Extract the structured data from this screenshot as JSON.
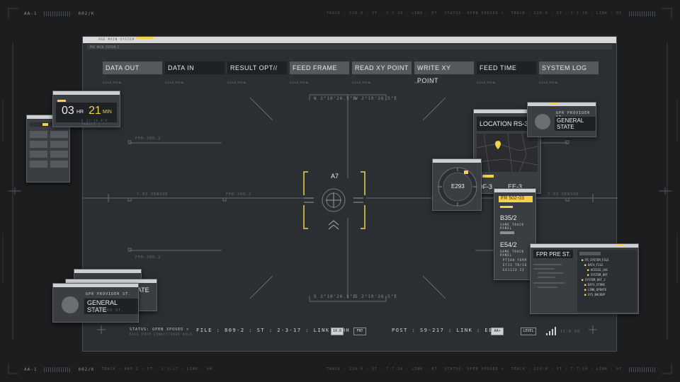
{
  "top_strip": {
    "left_code": "AA-1",
    "mid_code": "002/K",
    "track": "TRACK : 220-0 : ST : 7-7-10 : LINK : 07",
    "status": "STATUS: OPEN XPOSED >",
    "track2": "TRACK : 220-0 : ST : 7-7-10 : LINK : 07"
  },
  "bottom_strip": {
    "left_code": "AA-1",
    "mid_code": "002/K",
    "track": "TRACK : 809-2 : ST : 2-3-17 : LINK : HH",
    "track_mid": "TRACK : 220-0 : ST : 7-7-10 : LINK : 07",
    "status": "STATUS: OPEN XPOSED >",
    "track2": "TRACK : 220-0 : ST : 7-7-10 : LINK : 07"
  },
  "main": {
    "title_tab": "PRE MAIN SYSTEM",
    "subbar": "PRE MAIN SYSTEM 2",
    "nav": [
      {
        "label": "DATA OUT",
        "sub": "DOLE     PRIM"
      },
      {
        "label": "DATA IN",
        "sub": "DOLE     PRIM"
      },
      {
        "label": "RESULT OPT//",
        "sub": "DOLE     PRIM"
      },
      {
        "label": "FEED FRAME",
        "sub": "DOLE     PRIM"
      },
      {
        "label": "READ XY POINT",
        "sub": "DOLE     PRIM"
      },
      {
        "label": "WRITE XY POINT",
        "sub": "DOLE     PRIM"
      },
      {
        "label": "FEED TIME",
        "sub": "DOLE     PRIM"
      },
      {
        "label": "SYSTEM LOG",
        "sub": "DOLE     PRIM"
      }
    ],
    "coord_top_left": "N 2°10'26.5\"E",
    "coord_top_right": "W 2°10'26.5\"E",
    "coord_bottom_left": "S 2°10'26.5\"E",
    "coord_bottom_right": "S 2°10'26.5\"E",
    "target_label": "A7",
    "sensor_left": "7.03 SENSOR",
    "sensor_right": "7.03 SENSOR",
    "fpr_top": "FPR-300.2",
    "fpr_mid": "FPR-300.2",
    "fpr_bottom": "FPR-300.2",
    "status_left": "STATUS: OPEN XPOSED >",
    "status_left_sub": "DOLE PRIM  CONDITIONED HOLD",
    "file_info": "FILE : 809-2 : ST : 2-3-17 : LINK : HH",
    "btn_a": "10.8",
    "btn_b": "FNT",
    "post_info": "POST : S9-217 : LINK : EE",
    "btn_c": "AA+",
    "btn_level": "LEVEL",
    "signal_text": "11.8 80"
  },
  "timer_panel": {
    "hours": "03",
    "hr_unit": "HR",
    "minutes": "21",
    "min_unit": "MIN",
    "sub": "E 23'18.8\"E TARGET 2"
  },
  "general_state_top": {
    "provider": "GPR PROVIDER ST.",
    "title": "GENERAL STATE"
  },
  "general_state_bottom": {
    "provider": "GPR PROVIDER ST.",
    "title": "GENERAL STATE",
    "sub": "GPR PROV ST."
  },
  "general_state_shadow_title": "STATE",
  "location_panel": {
    "title": "LOCATION RS-34",
    "code1": "DF-3",
    "code2": "EE-3"
  },
  "compass_panel": {
    "label": "E293"
  },
  "list_panel": {
    "header": "FR 502-03",
    "items": [
      {
        "value": "B35/2",
        "sub": "SOME TRACK PANEL"
      },
      {
        "value": "E54/2",
        "sub": "SOME TRACK PANEL"
      }
    ],
    "lines": [
      "PT500 FORM",
      "ET13 TR/18",
      "EX1123 II"
    ]
  },
  "file_panel": {
    "title": "FPR PRE ST.",
    "folders": [
      "FR_SYSTEM_FILE",
      "DATA_FILE",
      "ACCESS_LOG",
      "SYSTEM_DAT",
      "SYSTEM_DAT_2",
      "DATA_STORE",
      "LINK_UPDATE",
      "SYS_BACKUP"
    ]
  },
  "colors": {
    "accent": "#f2d24b",
    "panel": "#3a3d41",
    "bg": "#1c1d1f"
  }
}
